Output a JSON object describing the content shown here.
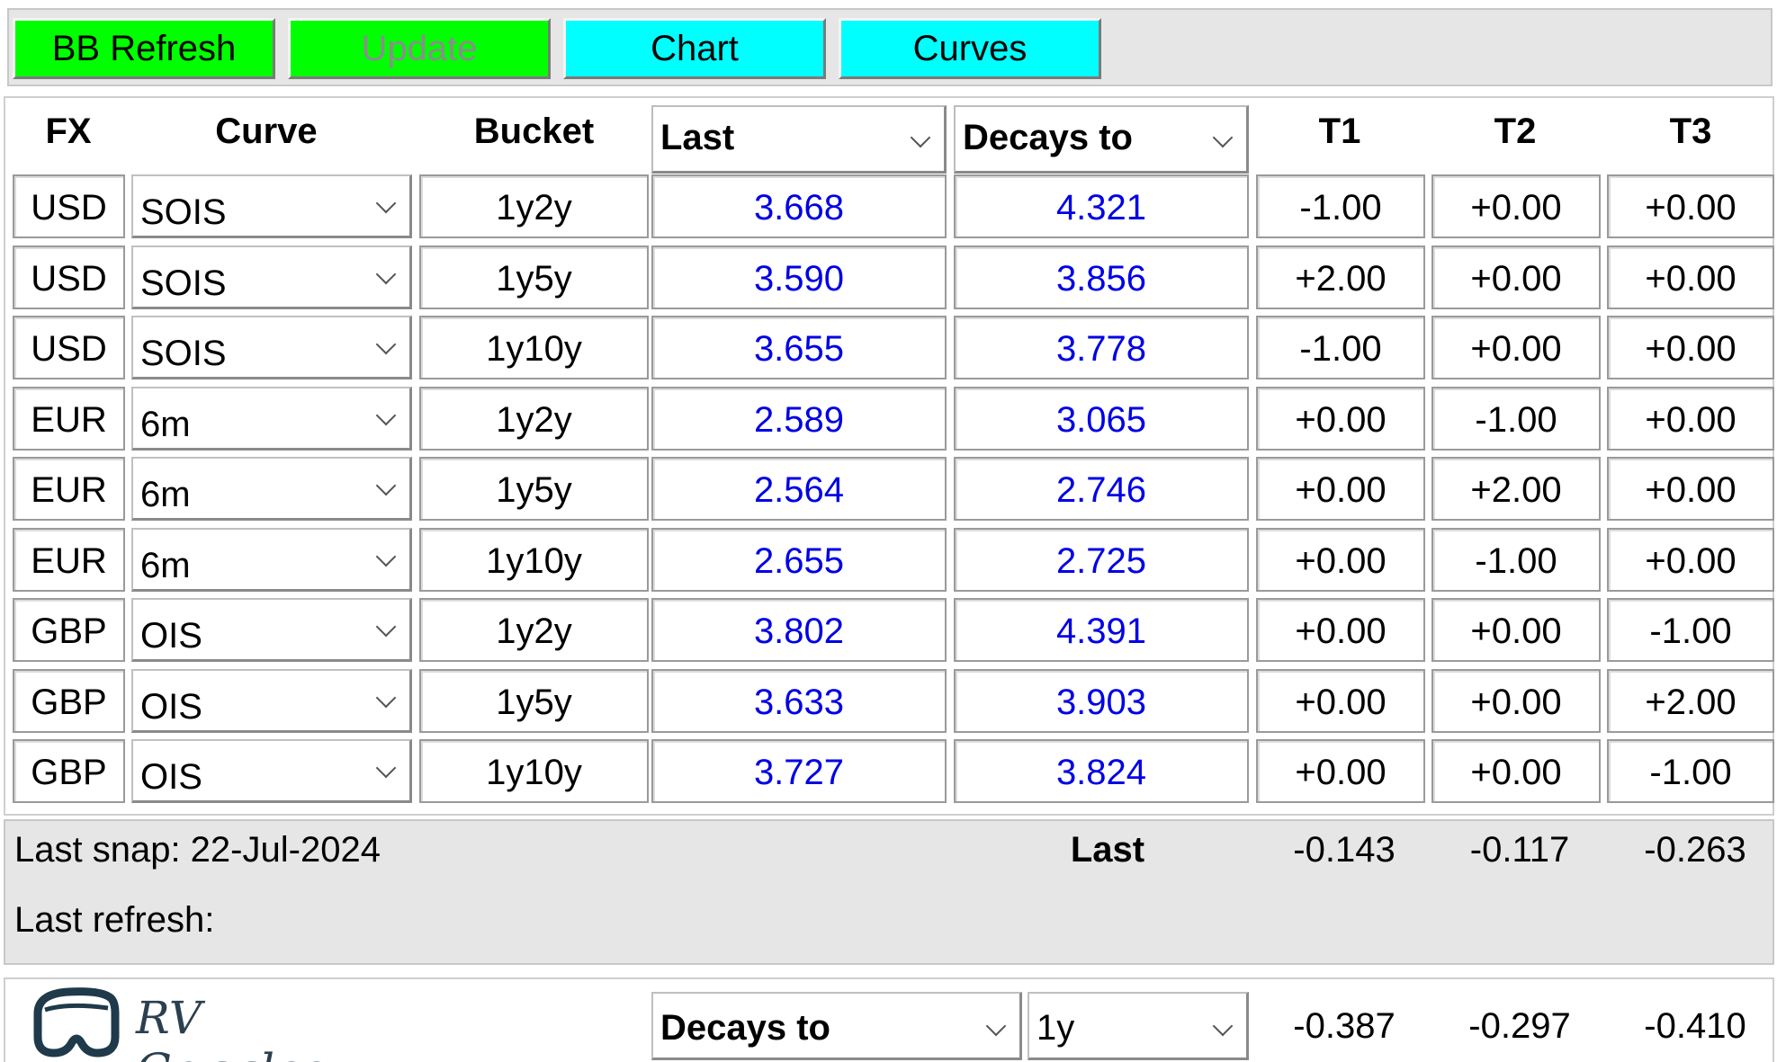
{
  "toolbar": {
    "bb_refresh": "BB Refresh",
    "update": "Update",
    "chart": "Chart",
    "curves": "Curves"
  },
  "header": {
    "fx": "FX",
    "curve": "Curve",
    "bucket": "Bucket",
    "last": "Last",
    "decays_to": "Decays to",
    "t1": "T1",
    "t2": "T2",
    "t3": "T3"
  },
  "rows": [
    {
      "fx": "USD",
      "curve": "SOIS",
      "bucket": "1y2y",
      "last": "3.668",
      "decays": "4.321",
      "t1": "-1.00",
      "t2": "+0.00",
      "t3": "+0.00"
    },
    {
      "fx": "USD",
      "curve": "SOIS",
      "bucket": "1y5y",
      "last": "3.590",
      "decays": "3.856",
      "t1": "+2.00",
      "t2": "+0.00",
      "t3": "+0.00"
    },
    {
      "fx": "USD",
      "curve": "SOIS",
      "bucket": "1y10y",
      "last": "3.655",
      "decays": "3.778",
      "t1": "-1.00",
      "t2": "+0.00",
      "t3": "+0.00"
    },
    {
      "fx": "EUR",
      "curve": "6m",
      "bucket": "1y2y",
      "last": "2.589",
      "decays": "3.065",
      "t1": "+0.00",
      "t2": "-1.00",
      "t3": "+0.00"
    },
    {
      "fx": "EUR",
      "curve": "6m",
      "bucket": "1y5y",
      "last": "2.564",
      "decays": "2.746",
      "t1": "+0.00",
      "t2": "+2.00",
      "t3": "+0.00"
    },
    {
      "fx": "EUR",
      "curve": "6m",
      "bucket": "1y10y",
      "last": "2.655",
      "decays": "2.725",
      "t1": "+0.00",
      "t2": "-1.00",
      "t3": "+0.00"
    },
    {
      "fx": "GBP",
      "curve": "OIS",
      "bucket": "1y2y",
      "last": "3.802",
      "decays": "4.391",
      "t1": "+0.00",
      "t2": "+0.00",
      "t3": "-1.00"
    },
    {
      "fx": "GBP",
      "curve": "OIS",
      "bucket": "1y5y",
      "last": "3.633",
      "decays": "3.903",
      "t1": "+0.00",
      "t2": "+0.00",
      "t3": "+2.00"
    },
    {
      "fx": "GBP",
      "curve": "OIS",
      "bucket": "1y10y",
      "last": "3.727",
      "decays": "3.824",
      "t1": "+0.00",
      "t2": "+0.00",
      "t3": "-1.00"
    }
  ],
  "summary": {
    "last_snap": "Last snap: 22-Jul-2024",
    "last_refresh": "Last refresh:",
    "label": "Last",
    "t1": "-0.143",
    "t2": "-0.117",
    "t3": "-0.263"
  },
  "bottom": {
    "logo_text": "RV Goggles",
    "mode_select": "Decays to",
    "horizon_select": "1y",
    "t1": "-0.387",
    "t2": "-0.297",
    "t3": "-0.410"
  },
  "colors": {
    "green_button": "#00ff00",
    "cyan_button": "#00ffff",
    "value_blue": "#0000e6",
    "panel_gray": "#e6e6e6"
  }
}
